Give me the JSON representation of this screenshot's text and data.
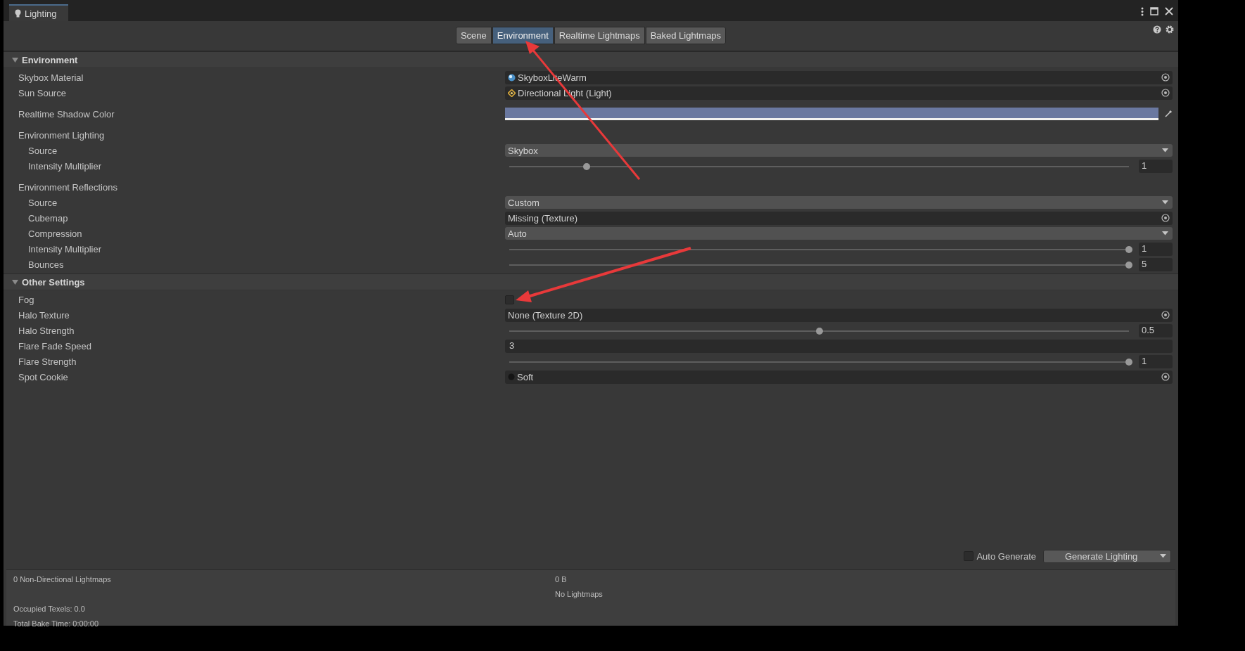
{
  "window": {
    "title": "Lighting"
  },
  "tabs": [
    {
      "label": "Scene",
      "selected": false
    },
    {
      "label": "Environment",
      "selected": true
    },
    {
      "label": "Realtime Lightmaps",
      "selected": false
    },
    {
      "label": "Baked Lightmaps",
      "selected": false
    }
  ],
  "sections": [
    {
      "title": "Environment",
      "expanded": true,
      "rows": [
        {
          "kind": "material",
          "label": "Skybox Material",
          "value": "SkyboxLiteWarm"
        },
        {
          "kind": "light",
          "label": "Sun Source",
          "value": "Directional Light (Light)"
        },
        {
          "kind": "color",
          "label": "Realtime Shadow Color",
          "color": "#6a78a0"
        },
        {
          "kind": "group",
          "label": "Environment Lighting",
          "children": [
            {
              "kind": "dropdown",
              "label": "Source",
              "value": "Skybox"
            },
            {
              "kind": "slider",
              "label": "Intensity Multiplier",
              "level": 0.125,
              "reading": "1"
            }
          ]
        },
        {
          "kind": "group",
          "label": "Environment Reflections",
          "children": [
            {
              "kind": "dropdown",
              "label": "Source",
              "value": "Custom"
            },
            {
              "kind": "object",
              "label": "Cubemap",
              "value": "Missing (Texture)"
            },
            {
              "kind": "dropdown",
              "label": "Compression",
              "value": "Auto"
            },
            {
              "kind": "slider",
              "label": "Intensity Multiplier",
              "level": 1,
              "reading": "1"
            },
            {
              "kind": "slider",
              "label": "Bounces",
              "level": 1,
              "reading": "5"
            }
          ]
        }
      ]
    },
    {
      "title": "Other Settings",
      "expanded": true,
      "rows": [
        {
          "kind": "checkbox",
          "label": "Fog",
          "checked": false
        },
        {
          "kind": "object",
          "label": "Halo Texture",
          "value": "None (Texture 2D)"
        },
        {
          "kind": "slider",
          "label": "Halo Strength",
          "level": 0.5,
          "reading": "0.5"
        },
        {
          "kind": "number",
          "label": "Flare Fade Speed",
          "value": "3"
        },
        {
          "kind": "slider",
          "label": "Flare Strength",
          "level": 1,
          "reading": "1"
        },
        {
          "kind": "texture",
          "label": "Spot Cookie",
          "value": "Soft"
        }
      ]
    }
  ],
  "bake": {
    "auto_generate": {
      "label": "Auto Generate",
      "checked": false
    },
    "button": "Generate Lighting"
  },
  "stats": {
    "lightmaps": "0 Non-Directional Lightmaps",
    "size": "0 B",
    "lightmap_list": "No Lightmaps",
    "occupied_texels": "Occupied Texels: 0.0",
    "bake_time": "Total Bake Time: 0:00:00"
  }
}
